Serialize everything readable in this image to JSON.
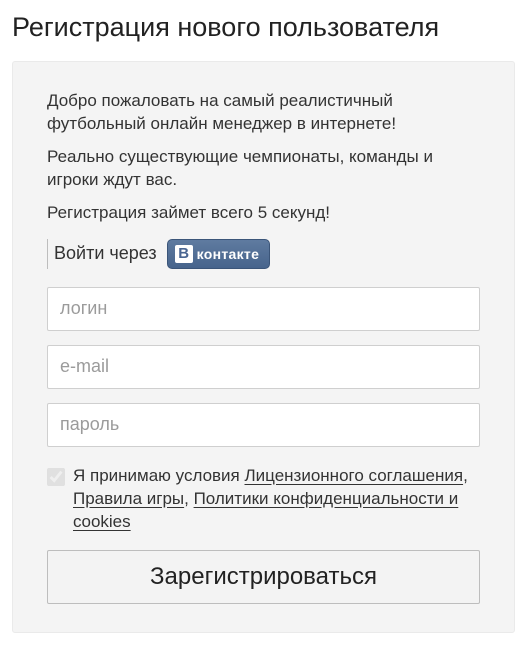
{
  "title": "Регистрация нового пользователя",
  "intro": {
    "p1": "Добро пожаловать на самый реалистичный футбольный онлайн менеджер в интернете!",
    "p2": "Реально существующие чемпионаты, команды и игроки ждут вас.",
    "p3": "Регистрация займет всего 5 секунд!"
  },
  "login_via": {
    "label": "Войти через",
    "vk_icon": "В",
    "vk_text": "контакте"
  },
  "fields": {
    "login_placeholder": "логин",
    "email_placeholder": "e-mail",
    "password_placeholder": "пароль"
  },
  "terms": {
    "prefix": "Я принимаю условия ",
    "link1": "Лицензионного соглашения",
    "sep1": ", ",
    "link2": "Правила игры",
    "sep2": ", ",
    "link3": "Политики конфиденциальности и cookies"
  },
  "register_button": "Зарегистрироваться"
}
